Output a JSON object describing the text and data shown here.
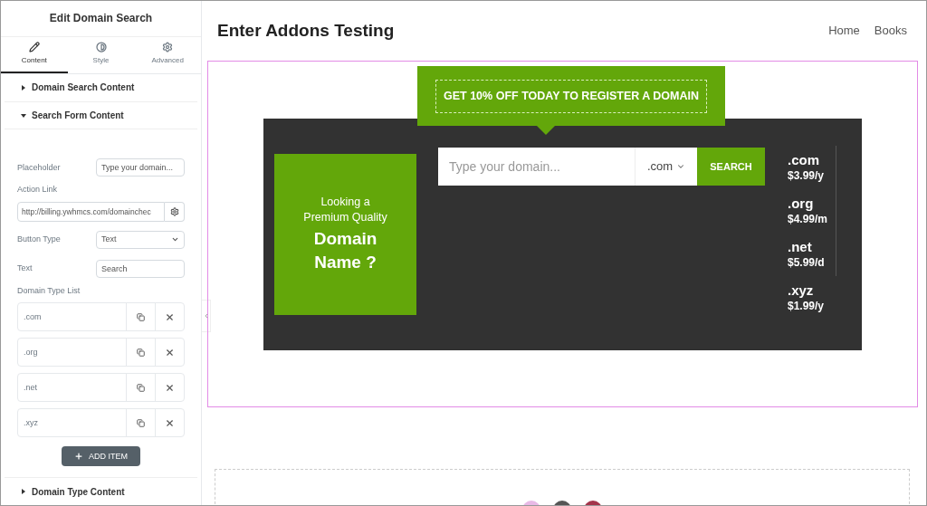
{
  "panel": {
    "title": "Edit Domain Search",
    "tabs": [
      {
        "label": "Content",
        "kind": "pencil",
        "selected": true
      },
      {
        "label": "Style",
        "kind": "contrast",
        "selected": false
      },
      {
        "label": "Advanced",
        "kind": "gear",
        "selected": false
      }
    ],
    "sections": [
      {
        "title": "Domain Search Content",
        "expanded": false
      },
      {
        "title": "Search Form Content",
        "expanded": true
      }
    ],
    "fields": [
      {
        "kind": "text",
        "label": "Placeholder",
        "value": "Type your domain..."
      },
      {
        "kind": "link",
        "label": "Action Link",
        "value": "http://billing.ywhmcs.com/domainchec"
      },
      {
        "kind": "select",
        "label": "Button Type",
        "value": "Text"
      },
      {
        "kind": "text",
        "label": "Text",
        "value": "Search"
      }
    ],
    "domain_type_list": {
      "label": "Domain Type List",
      "items": [
        ".com",
        ".org",
        ".net",
        ".xyz"
      ],
      "add_button": "ADD ITEM"
    },
    "footer_section": {
      "title": "Domain Type Content",
      "expanded": false
    }
  },
  "page": {
    "title": "Enter Addons Testing",
    "nav": [
      "Home",
      "Books"
    ],
    "widget": {
      "banner": "GET 10% OFF TODAY TO REGISTER A DOMAIN",
      "promo_intro": "Looking a Premium Quality",
      "promo_title": "Domain Name ?",
      "search_placeholder": "Type your domain...",
      "tld": ".com",
      "button": "SEARCH",
      "prices": [
        {
          "tld": ".com",
          "price": "$3.99/y"
        },
        {
          "tld": ".org",
          "price": "$4.99/m"
        },
        {
          "tld": ".net",
          "price": "$5.99/d"
        },
        {
          "tld": ".xyz",
          "price": "$1.99/y"
        }
      ]
    }
  }
}
